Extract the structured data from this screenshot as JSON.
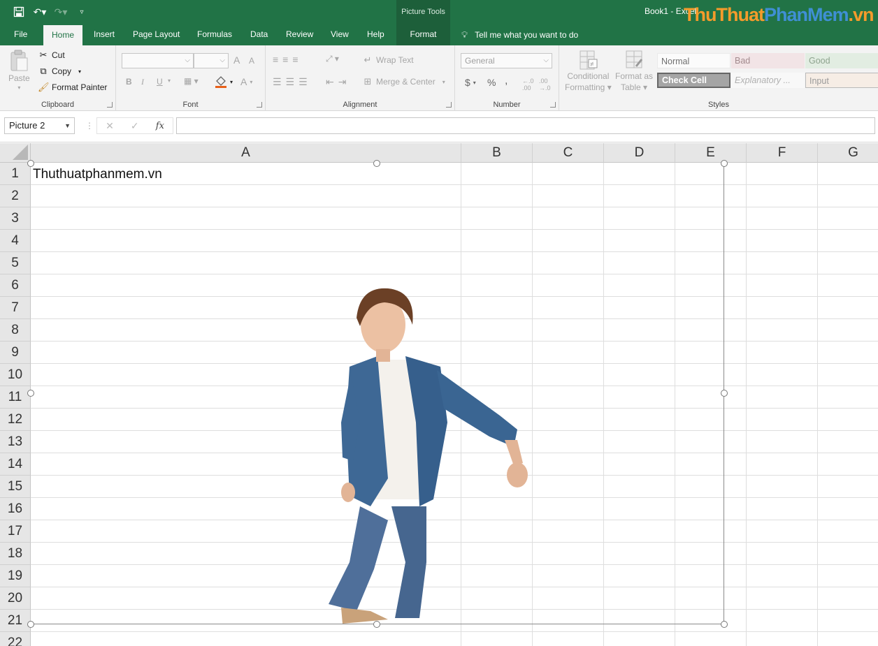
{
  "window": {
    "title": "Book1  -  Excel",
    "contextual_tab_group": "Picture Tools"
  },
  "watermark": {
    "part1": "ThuThuat",
    "part2": "PhanMem",
    "part3": ".vn"
  },
  "tabs": [
    "File",
    "Home",
    "Insert",
    "Page Layout",
    "Formulas",
    "Data",
    "Review",
    "View",
    "Help",
    "Format"
  ],
  "active_tab": "Home",
  "tell_me": "Tell me what you want to do",
  "clipboard": {
    "paste": "Paste",
    "cut": "Cut",
    "copy": "Copy",
    "format_painter": "Format Painter",
    "label": "Clipboard"
  },
  "font": {
    "label": "Font",
    "bold": "B",
    "italic": "I",
    "underline": "U",
    "grow": "A",
    "shrink": "A",
    "color": "A"
  },
  "alignment": {
    "wrap_text": "Wrap Text",
    "merge_center": "Merge & Center",
    "label": "Alignment"
  },
  "number": {
    "format": "General",
    "currency": "$",
    "percent": "%",
    "comma": ",",
    "label": "Number"
  },
  "styles_group": {
    "conditional": [
      "Conditional",
      "Formatting"
    ],
    "format_table": [
      "Format as",
      "Table"
    ],
    "cells": [
      "Normal",
      "Bad",
      "Good",
      "Check Cell",
      "Explanatory ...",
      "Input"
    ],
    "label": "Styles"
  },
  "formula_bar": {
    "name_box": "Picture 2",
    "cancel": "✕",
    "enter": "✓",
    "fx": "fx",
    "value": ""
  },
  "columns": [
    "A",
    "B",
    "C",
    "D",
    "E",
    "F",
    "G"
  ],
  "rows": [
    "1",
    "2",
    "3",
    "4",
    "5",
    "6",
    "7",
    "8",
    "9",
    "10",
    "11",
    "12",
    "13",
    "14",
    "15",
    "16",
    "17",
    "18",
    "19",
    "20",
    "21",
    "22"
  ],
  "cells": {
    "A1": "Thuthuatphanmem.vn"
  },
  "picture": {
    "name": "Picture 2",
    "subject": "boy in denim jacket"
  }
}
